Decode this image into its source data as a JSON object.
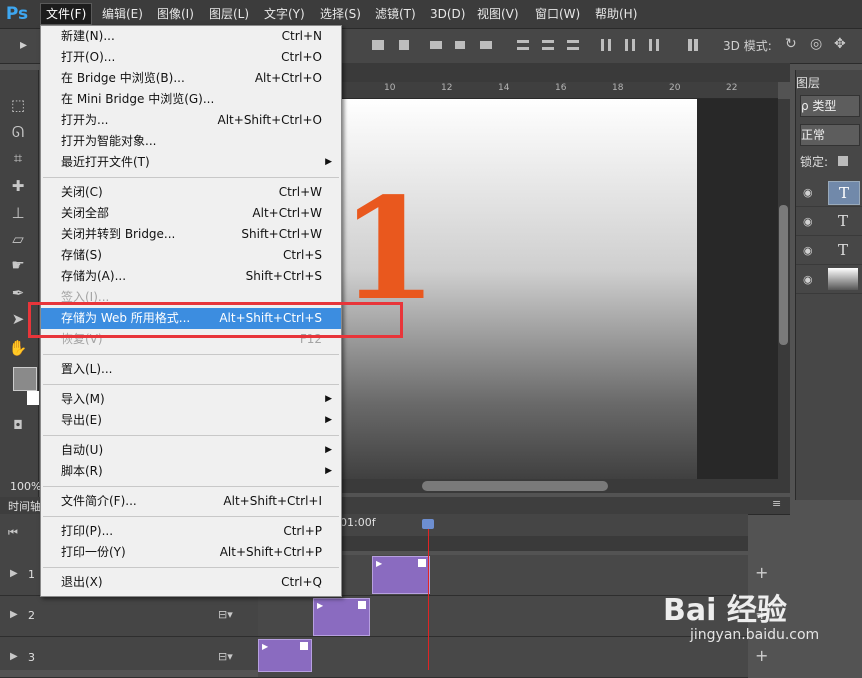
{
  "app": {
    "logo": "Ps"
  },
  "menubar": {
    "items": [
      "文件(F)",
      "编辑(E)",
      "图像(I)",
      "图层(L)",
      "文字(Y)",
      "选择(S)",
      "滤镜(T)",
      "3D(D)",
      "视图(V)",
      "窗口(W)",
      "帮助(H)"
    ]
  },
  "options": {
    "mode_3d": "3D 模式:"
  },
  "ruler": {
    "ticks": [
      "10",
      "12",
      "14",
      "16",
      "18",
      "20",
      "22"
    ]
  },
  "canvas": {
    "digit": "1",
    "digit_color": "#e9581e"
  },
  "status": {
    "zoom": "100%"
  },
  "timeline": {
    "title": "时间轴",
    "time_label": "01:00f",
    "rows": [
      "1",
      "2",
      "3"
    ]
  },
  "layers": {
    "tab": "图层",
    "filter": "ρ 类型",
    "blend": "正常",
    "lock": "锁定:",
    "items": [
      "T",
      "T",
      "T",
      ""
    ]
  },
  "file_menu": {
    "items": [
      {
        "label": "新建(N)...",
        "shortcut": "Ctrl+N"
      },
      {
        "label": "打开(O)...",
        "shortcut": "Ctrl+O"
      },
      {
        "label": "在 Bridge 中浏览(B)...",
        "shortcut": "Alt+Ctrl+O"
      },
      {
        "label": "在 Mini Bridge 中浏览(G)...",
        "shortcut": ""
      },
      {
        "label": "打开为...",
        "shortcut": "Alt+Shift+Ctrl+O"
      },
      {
        "label": "打开为智能对象...",
        "shortcut": ""
      },
      {
        "label": "最近打开文件(T)",
        "shortcut": ""
      },
      {
        "label": "关闭(C)",
        "shortcut": "Ctrl+W"
      },
      {
        "label": "关闭全部",
        "shortcut": "Alt+Ctrl+W"
      },
      {
        "label": "关闭并转到 Bridge...",
        "shortcut": "Shift+Ctrl+W"
      },
      {
        "label": "存储(S)",
        "shortcut": "Ctrl+S"
      },
      {
        "label": "存储为(A)...",
        "shortcut": "Shift+Ctrl+S"
      },
      {
        "label": "签入(I)...",
        "shortcut": ""
      },
      {
        "label": "存储为 Web 所用格式...",
        "shortcut": "Alt+Shift+Ctrl+S"
      },
      {
        "label": "恢复(V)",
        "shortcut": "F12"
      },
      {
        "label": "置入(L)...",
        "shortcut": ""
      },
      {
        "label": "导入(M)",
        "shortcut": ""
      },
      {
        "label": "导出(E)",
        "shortcut": ""
      },
      {
        "label": "自动(U)",
        "shortcut": ""
      },
      {
        "label": "脚本(R)",
        "shortcut": ""
      },
      {
        "label": "文件简介(F)...",
        "shortcut": "Alt+Shift+Ctrl+I"
      },
      {
        "label": "打印(P)...",
        "shortcut": "Ctrl+P"
      },
      {
        "label": "打印一份(Y)",
        "shortcut": "Alt+Shift+Ctrl+P"
      },
      {
        "label": "退出(X)",
        "shortcut": "Ctrl+Q"
      }
    ],
    "submenu_arrow": "▶"
  },
  "watermark": {
    "brand": "Bai 经验",
    "url": "jingyan.baidu.com"
  }
}
